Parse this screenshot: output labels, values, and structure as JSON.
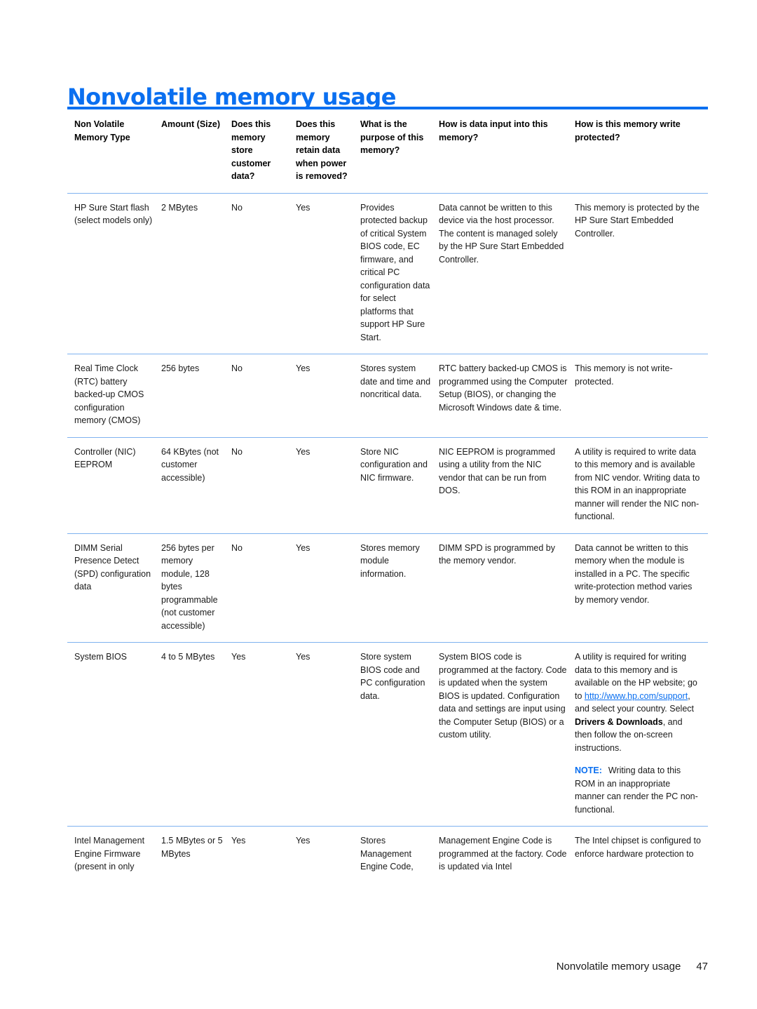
{
  "document": {
    "title": "Nonvolatile memory usage",
    "footer_title": "Nonvolatile memory usage",
    "page_number": "47",
    "accent_color": "#0a6ff0",
    "rule_color": "#7fb2ef"
  },
  "table": {
    "headers": [
      "Non Volatile Memory Type",
      "Amount (Size)",
      "Does this memory store customer data?",
      "Does this memory retain data when power is removed?",
      "What is the purpose of this memory?",
      "How is data input into this memory?",
      "How is this memory write protected?"
    ],
    "rows": [
      {
        "type": "HP Sure Start flash (select models only)",
        "amount": "2 MBytes",
        "stores_customer_data": "No",
        "retains_without_power": "Yes",
        "purpose": "Provides protected backup of critical System BIOS code, EC firmware, and critical PC configuration data for select platforms that support HP Sure Start.",
        "data_input": "Data cannot be written to this device via the host processor. The content is managed solely by the HP Sure Start Embedded Controller.",
        "write_protection": "This memory is protected by the HP Sure Start Embedded Controller."
      },
      {
        "type": "Real Time Clock (RTC) battery backed-up CMOS configuration memory (CMOS)",
        "amount": "256 bytes",
        "stores_customer_data": "No",
        "retains_without_power": "Yes",
        "purpose": "Stores system date and time and noncritical data.",
        "data_input": "RTC battery backed-up CMOS is programmed using the Computer Setup (BIOS), or changing the Microsoft Windows date & time.",
        "write_protection": "This memory is not write-protected."
      },
      {
        "type": "Controller (NIC) EEPROM",
        "amount": "64 KBytes (not customer accessible)",
        "stores_customer_data": "No",
        "retains_without_power": "Yes",
        "purpose": "Store NIC configuration and NIC firmware.",
        "data_input": "NIC EEPROM is programmed using a utility from the NIC vendor that can be run from DOS.",
        "write_protection": "A utility is required to write data to this memory and is available from NIC vendor. Writing data to this ROM in an inappropriate manner will render the NIC non-functional."
      },
      {
        "type": "DIMM Serial Presence Detect (SPD) configuration data",
        "amount": "256 bytes per memory module, 128 bytes programmable (not customer accessible)",
        "stores_customer_data": "No",
        "retains_without_power": "Yes",
        "purpose": "Stores memory module information.",
        "data_input": "DIMM SPD is programmed by the memory vendor.",
        "write_protection": "Data cannot be written to this memory when the module is installed in a PC. The specific write-protection method varies by memory vendor."
      },
      {
        "type": "System BIOS",
        "amount": "4 to 5 MBytes",
        "stores_customer_data": "Yes",
        "retains_without_power": "Yes",
        "purpose": "Store system BIOS code and PC configuration data.",
        "data_input": "System BIOS code is programmed at the factory. Code is updated when the system BIOS is updated. Configuration data and settings are input using the Computer Setup (BIOS) or a custom utility.",
        "write_protection_prefix": "A utility is required for writing data to this memory and is available on the HP website; go to ",
        "write_protection_link": "http://www.hp.com/support",
        "write_protection_middle": ", and select your country. Select ",
        "write_protection_bold": "Drivers & Downloads",
        "write_protection_suffix": ", and then follow the on-screen instructions.",
        "note_label": "NOTE:",
        "note_text": "Writing data to this ROM in an inappropriate manner can render the PC non-functional."
      },
      {
        "type": "Intel Management Engine Firmware (present in only",
        "amount": "1.5 MBytes or 5 MBytes",
        "stores_customer_data": "Yes",
        "retains_without_power": "Yes",
        "purpose": "Stores Management Engine Code,",
        "data_input": "Management Engine Code is programmed at the factory. Code is updated via Intel",
        "write_protection": "The Intel chipset is configured to enforce hardware protection to"
      }
    ]
  }
}
